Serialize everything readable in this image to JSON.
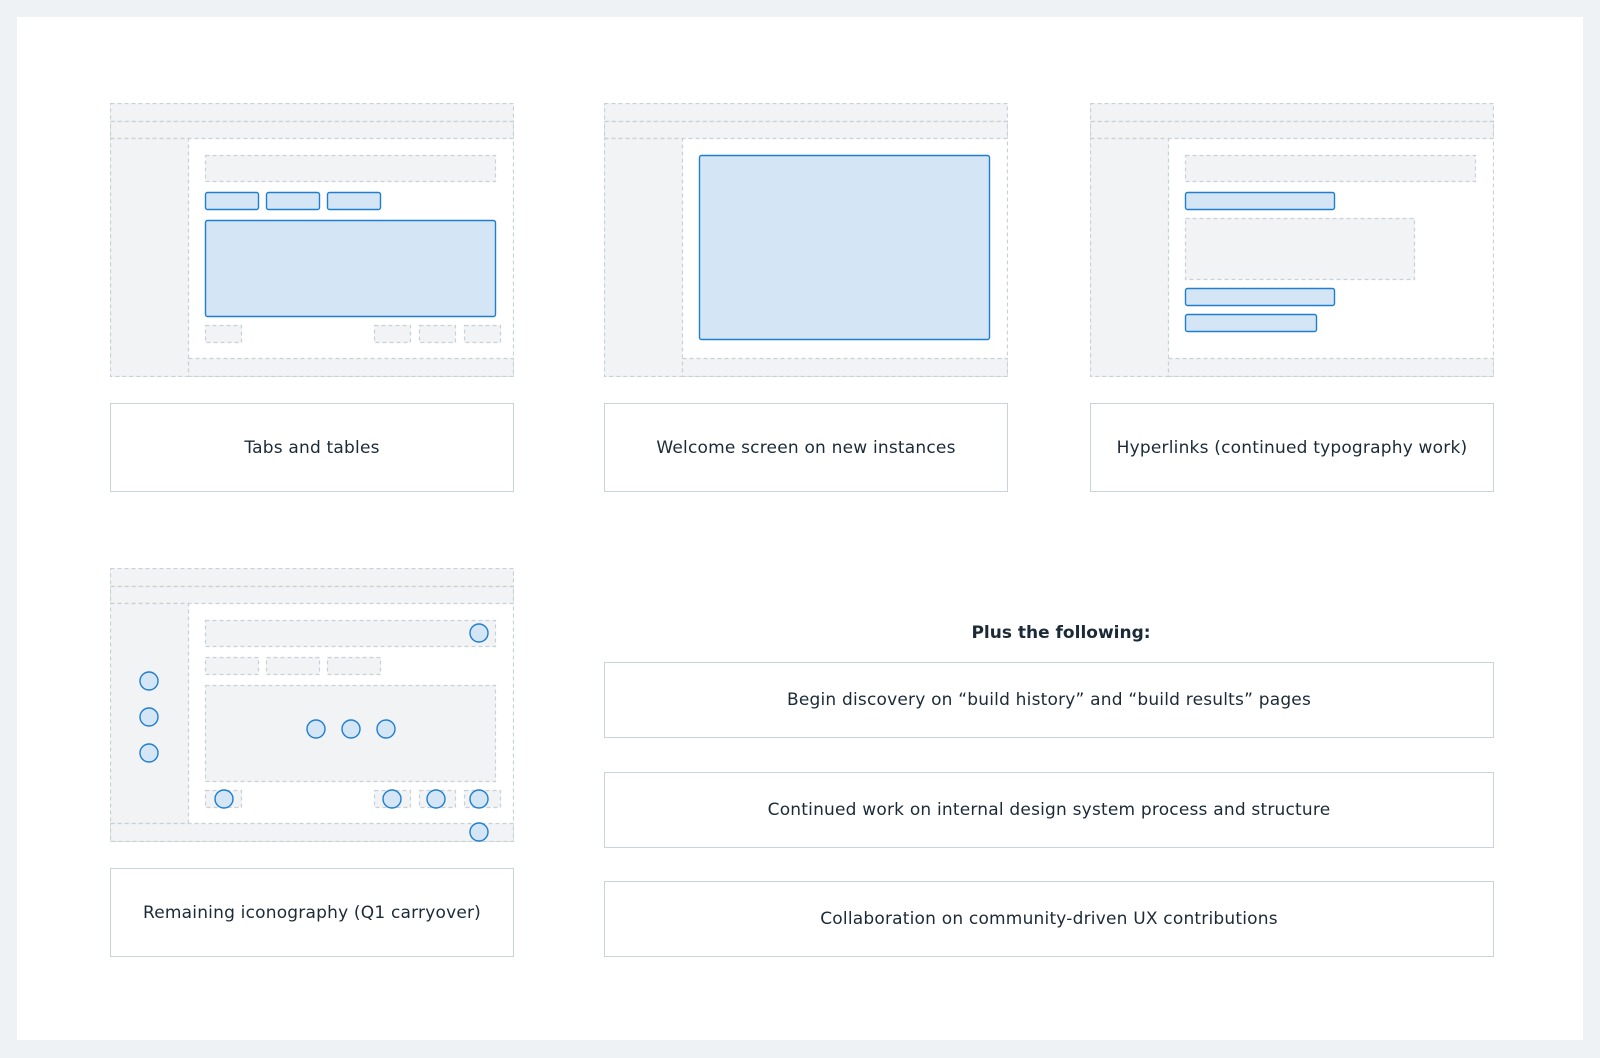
{
  "cards": [
    {
      "title": "Tabs and tables"
    },
    {
      "title": "Welcome screen on new instances"
    },
    {
      "title": "Hyperlinks (continued typography work)"
    },
    {
      "title": "Remaining iconography (Q1 carryover)"
    }
  ],
  "plus": {
    "heading": "Plus the following:",
    "items": [
      "Begin discovery on “build history” and “build results” pages",
      "Continued work on internal design system process and structure",
      "Collaboration on community-driven UX contributions"
    ]
  },
  "colors": {
    "background": "#eff2f5",
    "panel": "#ffffff",
    "highlight_fill": "#d4e5f5",
    "highlight_stroke": "#1f7ecf",
    "muted_fill": "#f1f3f5",
    "dashed_stroke": "#c8d0d8"
  }
}
